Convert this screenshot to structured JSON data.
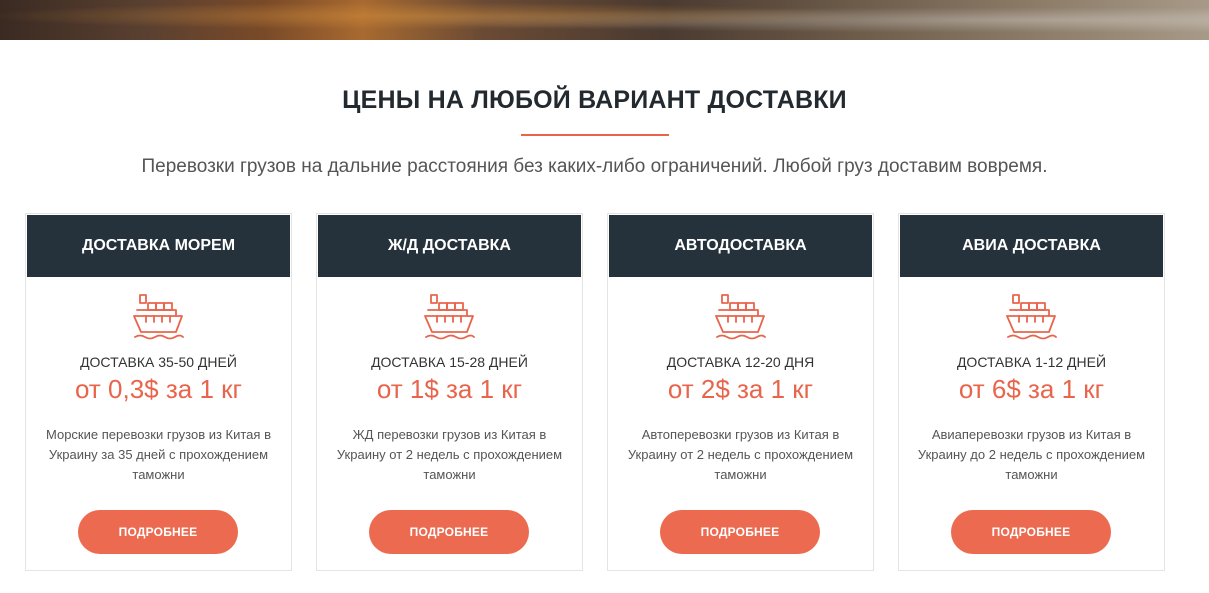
{
  "section": {
    "title": "ЦЕНЫ НА ЛЮБОЙ ВАРИАНТ ДОСТАВКИ",
    "subtitle": "Перевозки грузов на дальние расстояния без каких-либо ограничений. Любой груз доставим вовремя."
  },
  "colors": {
    "accent": "#e8654c",
    "header_bg": "#25323c",
    "button_bg": "#ec6a50"
  },
  "cards": [
    {
      "header": "ДОСТАВКА МОРЕМ",
      "icon": "cargo-ship-icon",
      "term": "ДОСТАВКА 35-50 ДНЕЙ",
      "price": "от 0,3$ за 1 кг",
      "description": "Морские перевозки грузов из Китая в Украину за 35 дней с прохождением таможни",
      "button": "ПОДРОБНЕЕ"
    },
    {
      "header": "Ж/Д ДОСТАВКА",
      "icon": "cargo-ship-icon",
      "term": "ДОСТАВКА 15-28 ДНЕЙ",
      "price": "от 1$ за 1 кг",
      "description": "ЖД перевозки грузов из Китая в Украину от 2 недель с прохождением таможни",
      "button": "ПОДРОБНЕЕ"
    },
    {
      "header": "АВТОДОСТАВКА",
      "icon": "cargo-ship-icon",
      "term": "ДОСТАВКА 12-20 ДНЯ",
      "price": "от 2$ за 1 кг",
      "description": "Автоперевозки грузов из Китая в Украину от 2 недель с прохождением таможни",
      "button": "ПОДРОБНЕЕ"
    },
    {
      "header": "АВИА ДОСТАВКА",
      "icon": "cargo-ship-icon",
      "term": "ДОСТАВКА 1-12 ДНЕЙ",
      "price": "от 6$ за 1 кг",
      "description": "Авиаперевозки грузов из Китая в Украину до 2 недель с прохождением таможни",
      "button": "ПОДРОБНЕЕ"
    }
  ]
}
